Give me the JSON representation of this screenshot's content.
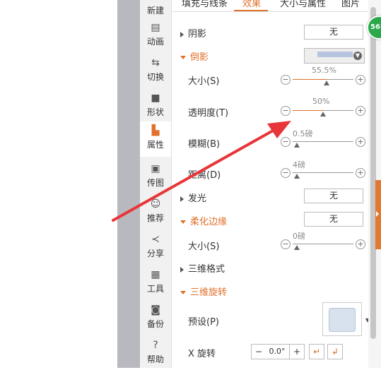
{
  "tabs": [
    "填充与线条",
    "效果",
    "大小与属性",
    "图片"
  ],
  "strip": [
    {
      "label": "新建",
      "icon": "new-icon"
    },
    {
      "label": "动画",
      "icon": "animation-icon"
    },
    {
      "label": "切换",
      "icon": "transition-icon"
    },
    {
      "label": "形状",
      "icon": "shape-icon"
    },
    {
      "label": "属性",
      "icon": "properties-icon"
    },
    {
      "label": "传图",
      "icon": "upload-image-icon"
    },
    {
      "label": "推荐",
      "icon": "recommend-icon"
    },
    {
      "label": "分享",
      "icon": "share-icon"
    },
    {
      "label": "工具",
      "icon": "toolbox-icon"
    },
    {
      "label": "备份",
      "icon": "backup-icon"
    },
    {
      "label": "帮助",
      "icon": "help-icon"
    }
  ],
  "sections": {
    "shadow": "阴影",
    "reflection": "倒影",
    "glow": "发光",
    "soft_edges": "柔化边缘",
    "threed_format": "三维格式",
    "threed_rotation": "三维旋转"
  },
  "values": {
    "shadow_value": "无",
    "glow_value": "无",
    "soft_edges_value": "无"
  },
  "reflection": {
    "size_label": "大小(S)",
    "size_value": "55.5%",
    "size_fraction": 0.555,
    "transparency_label": "透明度(T)",
    "transparency_value": "50%",
    "transparency_fraction": 0.5,
    "blur_label": "模糊(B)",
    "blur_value": "0.5磅",
    "blur_fraction": 0.0,
    "distance_label": "距离(D)",
    "distance_value": "4磅",
    "distance_fraction": 0.0
  },
  "soft_edges": {
    "size_label": "大小(S)",
    "size_value": "0磅",
    "size_fraction": 0.0
  },
  "rotation": {
    "preset_label": "预设(P)",
    "x_label": "X 旋转",
    "x_value": "0.0°"
  },
  "badge": "56",
  "colors": {
    "accent": "#e0702b",
    "reflection_swatch": "#b6c4e0",
    "badge": "#2aa84a",
    "annotation_arrow": "#e8353a"
  }
}
